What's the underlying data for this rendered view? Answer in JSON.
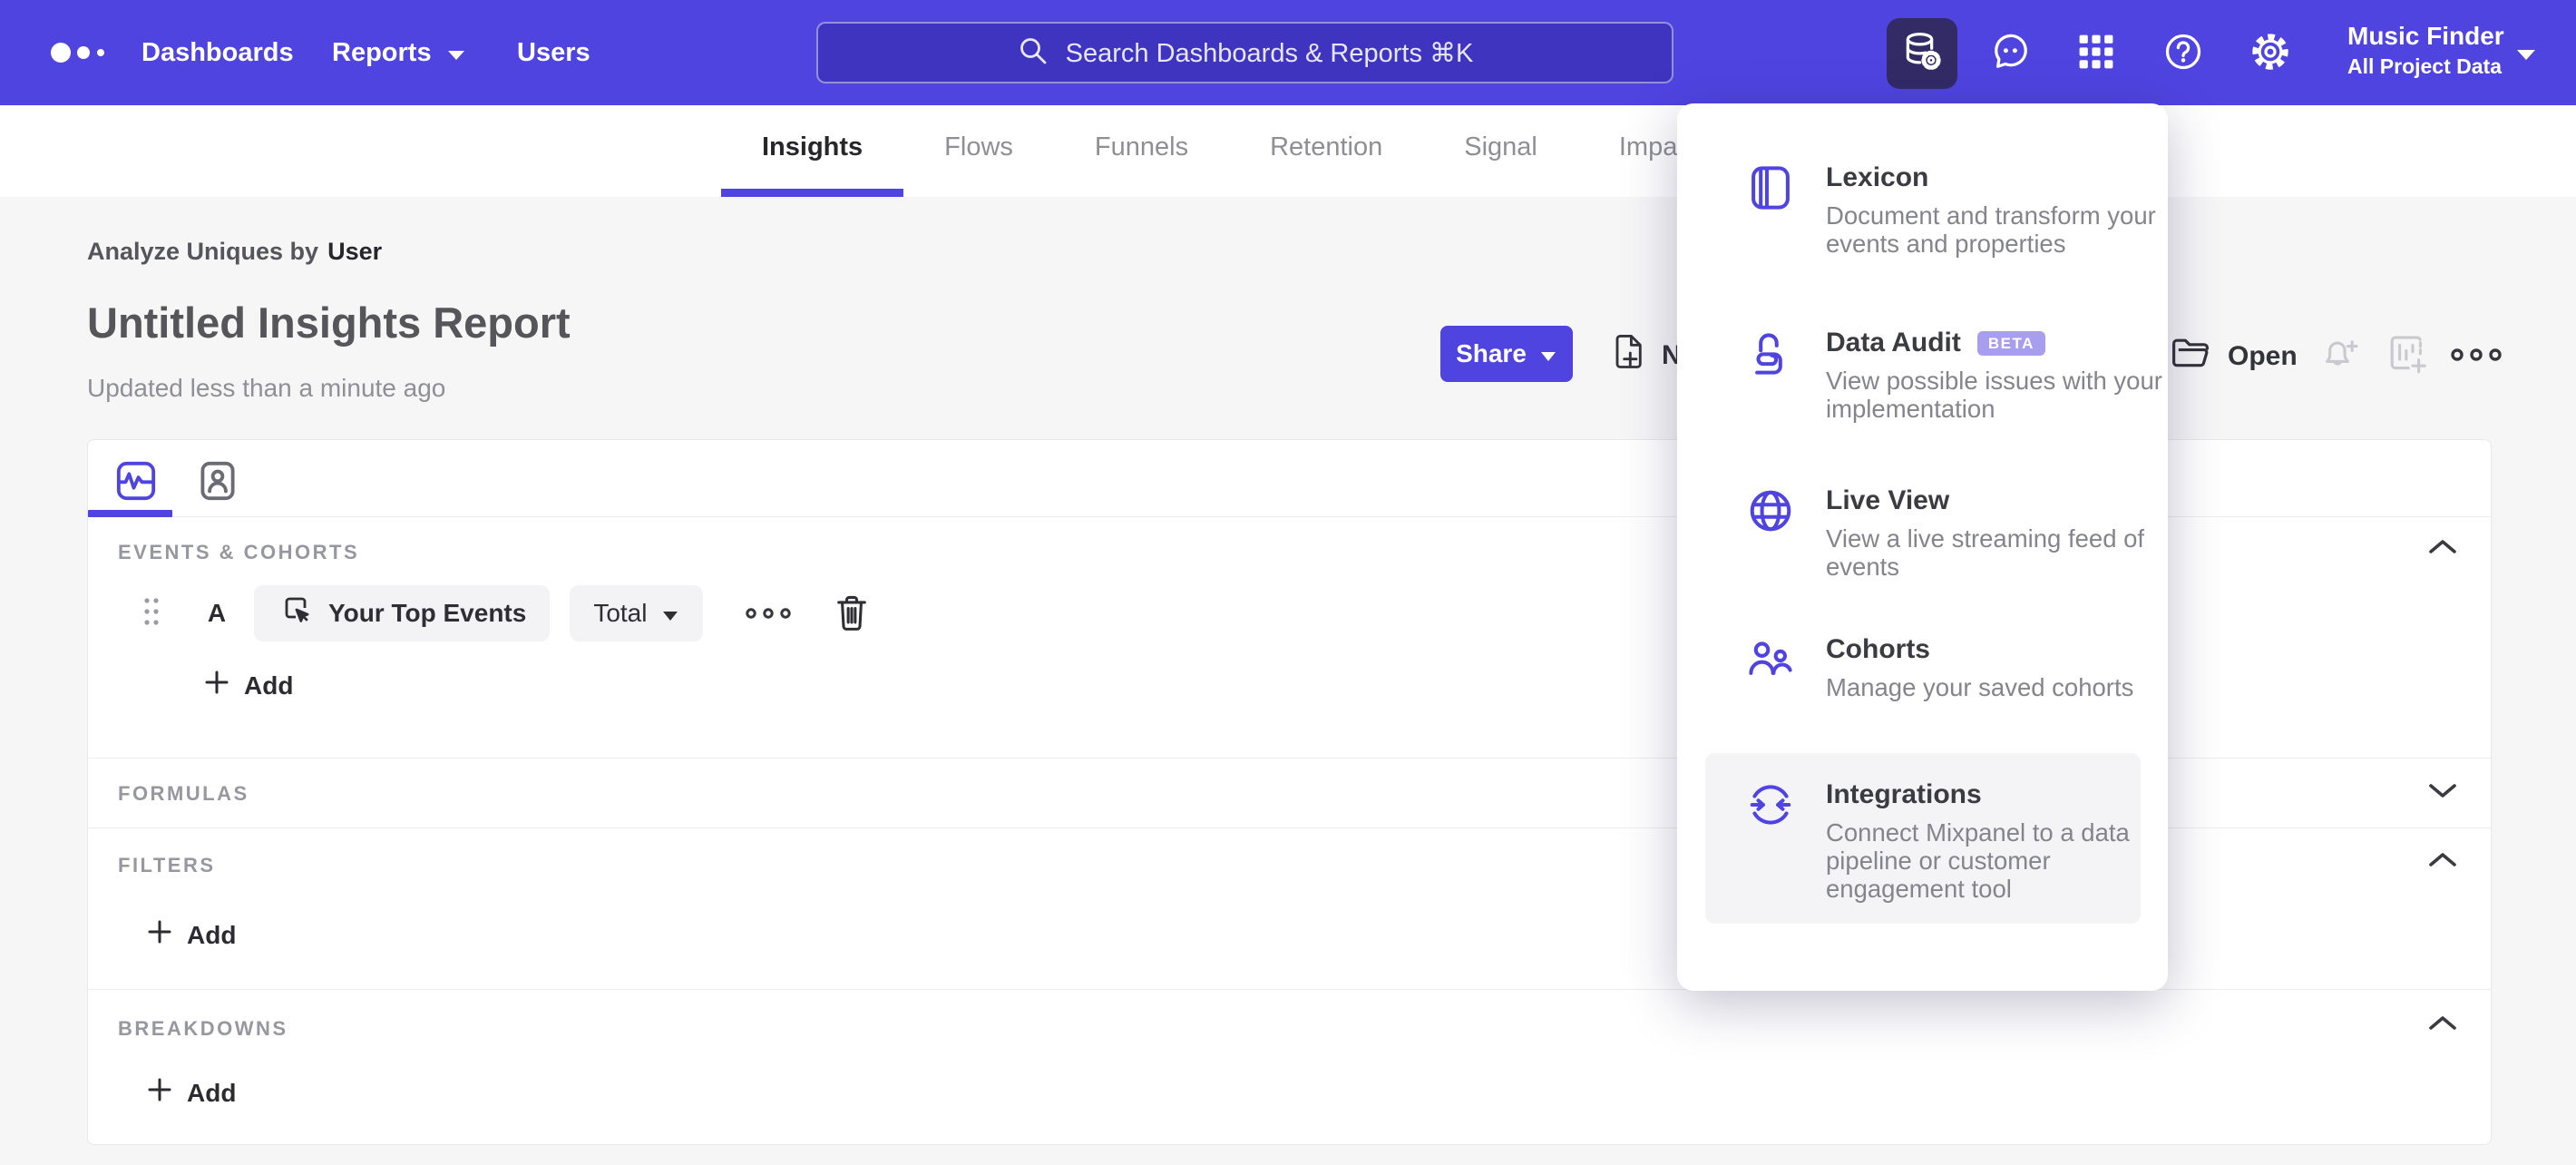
{
  "topbar": {
    "nav": [
      {
        "label": "Dashboards"
      },
      {
        "label": "Reports"
      },
      {
        "label": "Users"
      }
    ],
    "search_placeholder": "Search Dashboards & Reports ⌘K",
    "project": {
      "name": "Music Finder",
      "scope": "All Project Data"
    },
    "icons": [
      "data-management-icon",
      "support-chat-icon",
      "apps-grid-icon",
      "help-icon",
      "settings-gear-icon"
    ]
  },
  "tabs": {
    "items": [
      "Insights",
      "Flows",
      "Funnels",
      "Retention",
      "Signal",
      "Impact"
    ],
    "active": "Insights"
  },
  "report": {
    "analyze_prefix": "Analyze Uniques by",
    "analyze_value": "User",
    "title": "Untitled Insights Report",
    "updated": "Updated less than a minute ago",
    "share_label": "Share",
    "note_label": "Note",
    "open_label": "Open"
  },
  "menu": {
    "items": [
      {
        "title": "Lexicon",
        "badge": "",
        "icon": "book-icon",
        "desc": "Document and transform your events and properties"
      },
      {
        "title": "Data Audit",
        "badge": "BETA",
        "icon": "data-audit-lock-icon",
        "desc": "View possible issues with your implementation"
      },
      {
        "title": "Live View",
        "badge": "",
        "icon": "globe-icon",
        "desc": "View a live streaming feed of events"
      },
      {
        "title": "Cohorts",
        "badge": "",
        "icon": "cohorts-users-icon",
        "desc": "Manage your saved cohorts"
      },
      {
        "title": "Integrations",
        "badge": "",
        "icon": "sync-arrows-icon",
        "desc": "Connect Mixpanel to a data pipeline or customer engagement tool"
      }
    ]
  },
  "builder": {
    "sections": [
      {
        "label": "EVENTS & COHORTS",
        "collapse": "up"
      },
      {
        "label": "FORMULAS",
        "collapse": "down"
      },
      {
        "label": "FILTERS",
        "collapse": "up"
      },
      {
        "label": "BREAKDOWNS",
        "collapse": "up"
      }
    ],
    "event_row": {
      "letter": "A",
      "event_name": "Your Top Events",
      "metric": "Total"
    },
    "add_label": "Add"
  }
}
